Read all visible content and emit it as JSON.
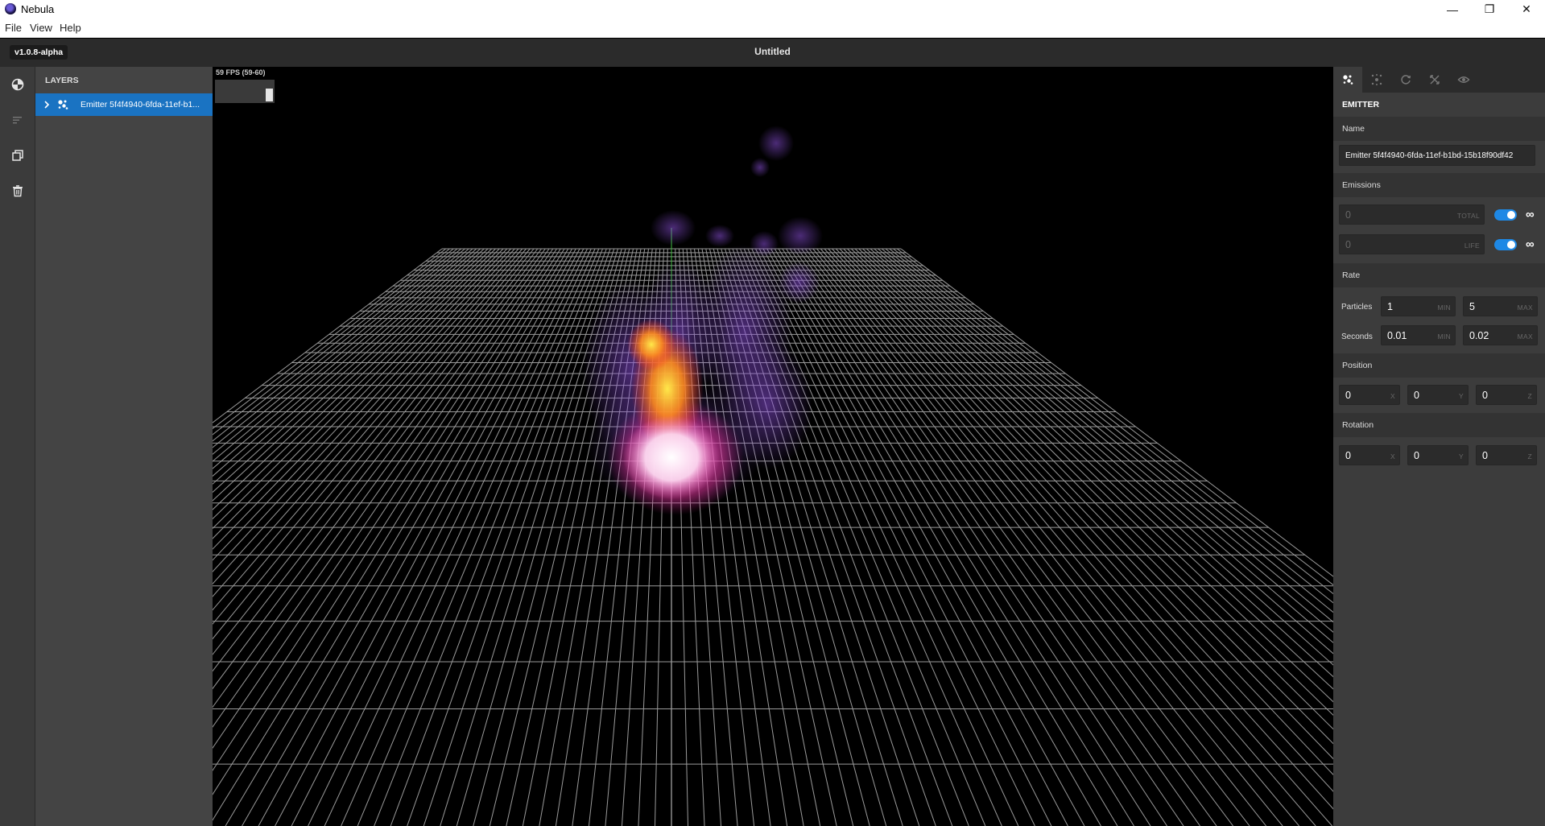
{
  "window": {
    "title": "Nebula",
    "minimize": "—",
    "maximize": "❐",
    "close": "✕"
  },
  "menu": {
    "items": [
      "File",
      "View",
      "Help"
    ]
  },
  "header": {
    "version": "v1.0.8-alpha",
    "document_title": "Untitled"
  },
  "toolbar": {
    "buttons": [
      "palette-icon",
      "text-list-icon",
      "duplicate-icon",
      "trash-icon"
    ]
  },
  "layers": {
    "title": "LAYERS",
    "items": [
      {
        "label": "Emitter 5f4f4940-6fda-11ef-b1...",
        "icon": "emitter-icon",
        "selected": true
      }
    ]
  },
  "viewport": {
    "fps_text": "59 FPS (59-60)"
  },
  "properties": {
    "tabs": [
      "emitter-icon",
      "particles-icon",
      "rotate-icon",
      "behaviour-icon",
      "eye-icon"
    ],
    "section_title": "EMITTER",
    "name_label": "Name",
    "name_value": "Emitter 5f4f4940-6fda-11ef-b1bd-15b18f90df42",
    "emissions": {
      "label": "Emissions",
      "total": {
        "value": "0",
        "unit": "TOTAL",
        "infinite": true
      },
      "life": {
        "value": "0",
        "unit": "LIFE",
        "infinite": true
      },
      "infinity_symbol": "∞"
    },
    "rate": {
      "label": "Rate",
      "particles": {
        "label": "Particles",
        "min": "1",
        "max": "5"
      },
      "seconds": {
        "label": "Seconds",
        "min": "0.01",
        "max": "0.02"
      },
      "min_unit": "MIN",
      "max_unit": "MAX"
    },
    "position": {
      "label": "Position",
      "x": "0",
      "y": "0",
      "z": "0"
    },
    "rotation": {
      "label": "Rotation",
      "x": "0",
      "y": "0",
      "z": "0"
    },
    "axis_units": {
      "x": "X",
      "y": "Y",
      "z": "Z"
    }
  },
  "colors": {
    "accent": "#1a73c2",
    "toggle": "#1e88e5",
    "panel": "#3c3c3c"
  }
}
